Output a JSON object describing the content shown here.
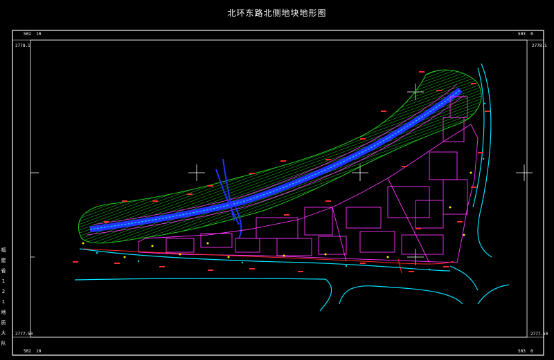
{
  "title": "北环东路北侧地块地形图",
  "corners": {
    "top_left_x": "502",
    "top_left_x2": "10",
    "top_right_x": "503",
    "top_right_x2": "0",
    "top_left_y": "2778.1",
    "top_right_y": "2778.1",
    "bottom_left_y": "2777.50",
    "bottom_right_y": "2777.50",
    "bottom_left_x": "502",
    "bottom_left_x2": "10",
    "bottom_right_x": "503",
    "bottom_right_x2": "0"
  },
  "side_text": [
    "福",
    "建",
    "省",
    "1",
    "2",
    "1",
    "地",
    "质",
    "大",
    "队"
  ],
  "colors": {
    "slope": "#22cc22",
    "road": "#00e5ff",
    "building": "#ff33ff",
    "label": "#ff2a2a",
    "frame": "#ffffff",
    "highway": "#2233ff"
  }
}
